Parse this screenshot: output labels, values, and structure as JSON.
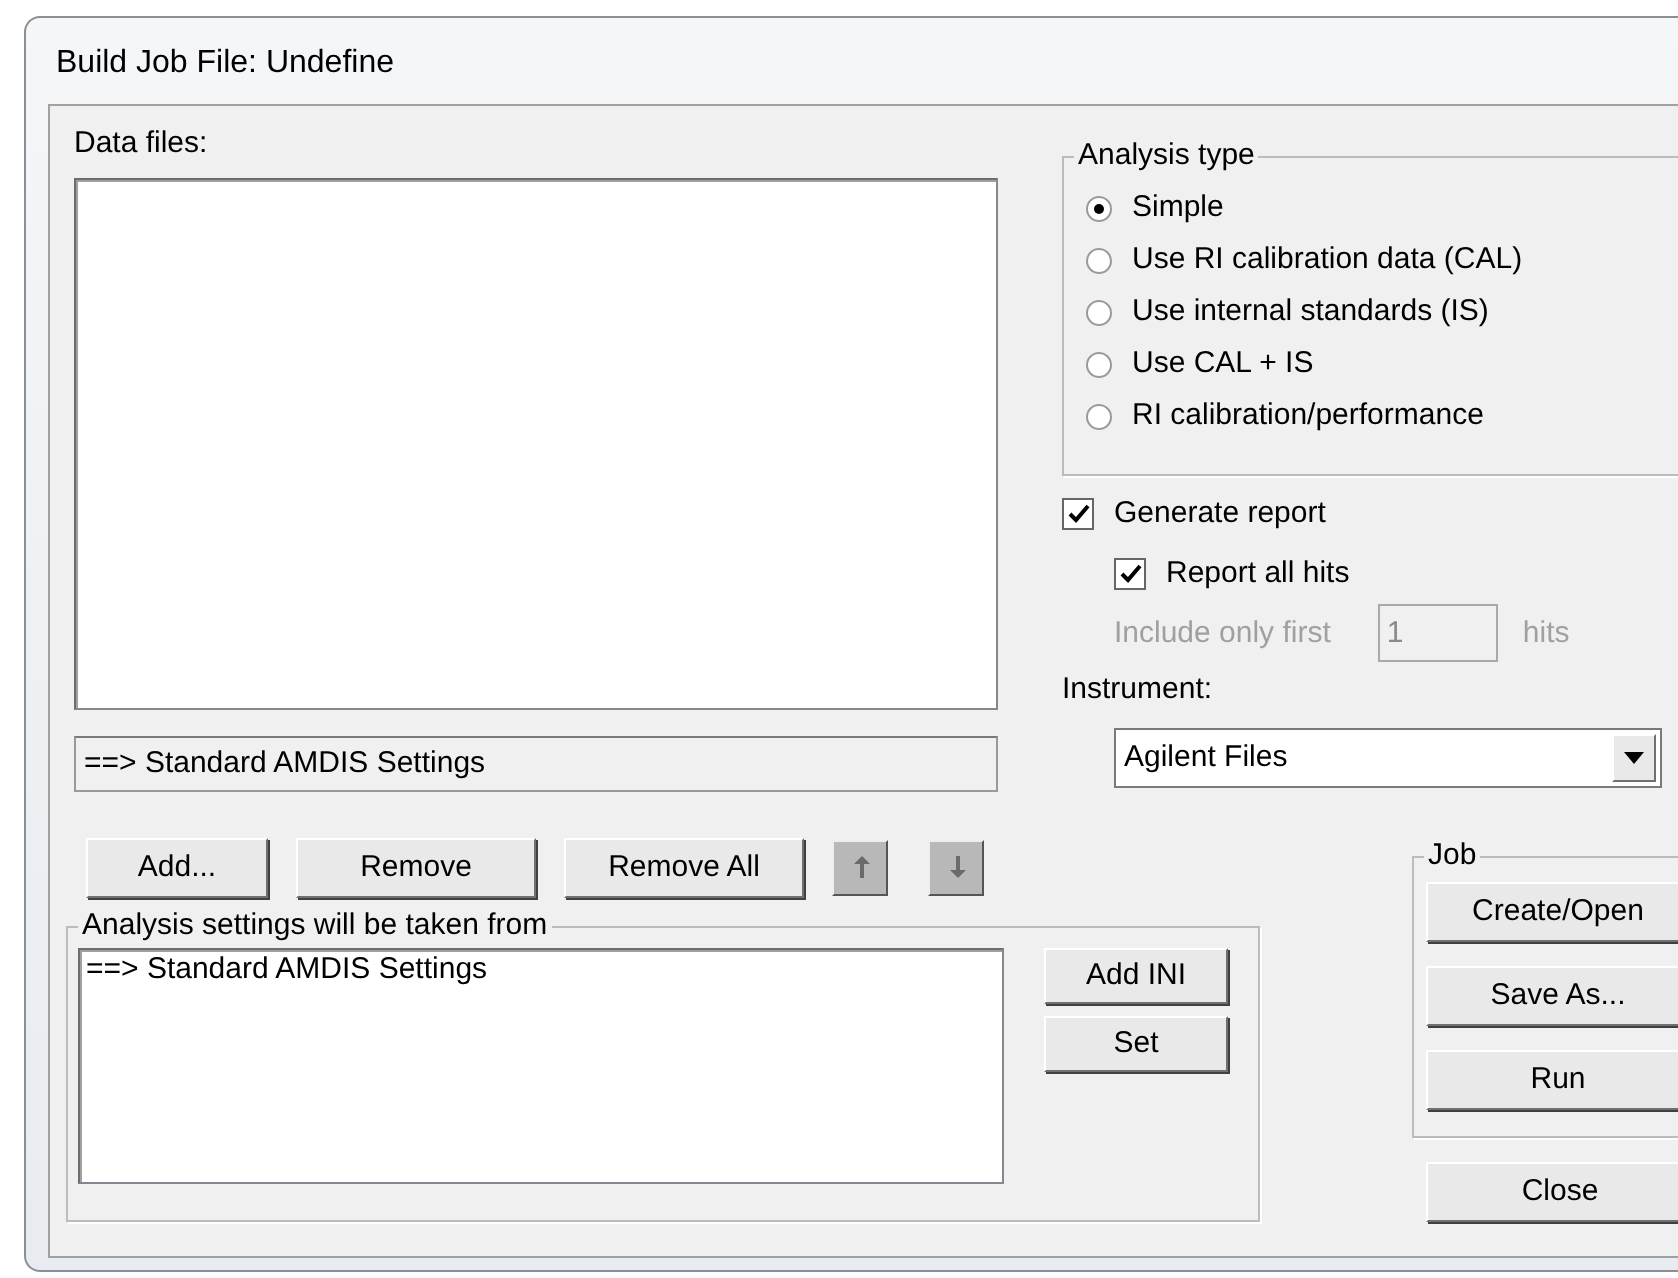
{
  "window": {
    "title": "Build Job File: Undefine"
  },
  "data_files": {
    "label": "Data files:",
    "status": "==> Standard AMDIS Settings"
  },
  "file_buttons": [
    {
      "kind": "text",
      "label": "Add..."
    },
    {
      "kind": "text",
      "label": "Remove"
    },
    {
      "kind": "text",
      "label": "Remove All"
    },
    {
      "kind": "up"
    },
    {
      "kind": "down"
    }
  ],
  "analysis_settings": {
    "title": "Analysis settings will be taken from",
    "items": [
      "==> Standard AMDIS Settings"
    ],
    "buttons": [
      "Add INI",
      "Set"
    ]
  },
  "analysis_type": {
    "title": "Analysis type",
    "options": [
      {
        "label": "Simple",
        "selected": true
      },
      {
        "label": "Use RI calibration data (CAL)",
        "selected": false
      },
      {
        "label": "Use internal standards (IS)",
        "selected": false
      },
      {
        "label": "Use CAL + IS",
        "selected": false
      },
      {
        "label": "RI calibration/performance",
        "selected": false
      }
    ]
  },
  "generate_report": {
    "label": "Generate report",
    "checked": true
  },
  "report_all_hits": {
    "label": "Report all hits",
    "checked": true
  },
  "include_first": {
    "label": "Include only first",
    "value": "1",
    "suffix": "hits",
    "disabled": true
  },
  "instrument": {
    "label": "Instrument:",
    "value": "Agilent Files"
  },
  "job": {
    "title": "Job",
    "buttons": [
      "Create/Open",
      "Save As...",
      "Run"
    ]
  },
  "close_button": "Close"
}
